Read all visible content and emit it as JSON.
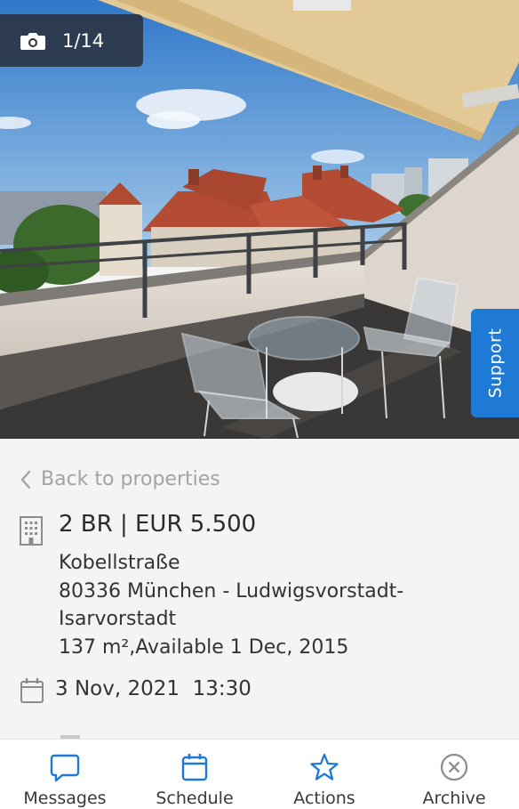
{
  "gallery": {
    "counter": "1/14",
    "icon": "camera-icon"
  },
  "support": {
    "label": "Support"
  },
  "details": {
    "back_label": "Back to properties",
    "title": "2 BR | EUR 5.500",
    "address_lines": [
      "Kobellstraße",
      "80336 München - Ludwigsvorstadt-",
      "Isarvorstadt",
      "137 m²,Available 1 Dec, 2015"
    ],
    "appointment": "3 Nov, 2021  13:30"
  },
  "nav": {
    "items": [
      {
        "label": "Messages",
        "icon": "chat-bubble-icon"
      },
      {
        "label": "Schedule",
        "icon": "calendar-icon"
      },
      {
        "label": "Actions",
        "icon": "star-icon"
      },
      {
        "label": "Archive",
        "icon": "close-circle-icon"
      }
    ]
  },
  "colors": {
    "accent": "#1f7ad6",
    "text": "#2f2f2f",
    "muted": "#a3a3a3",
    "background": "#f4f4f4"
  }
}
